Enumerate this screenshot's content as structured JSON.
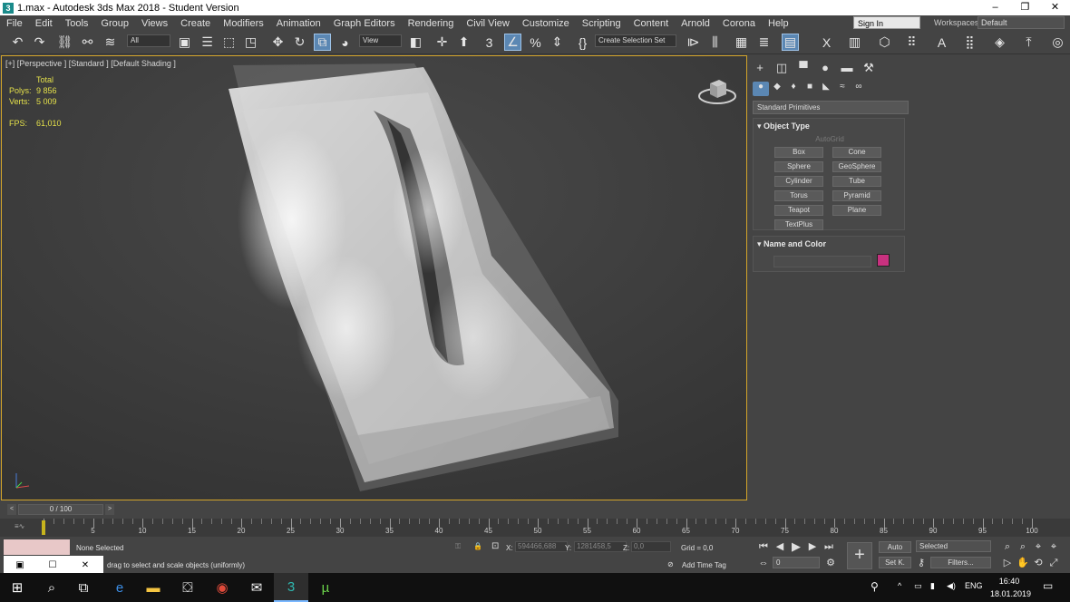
{
  "window": {
    "title": "1.max - Autodesk 3ds Max 2018 - Student Version",
    "app_icon_letter": "3",
    "minimize_glyph": "–",
    "restore_glyph": "❐",
    "close_glyph": "✕"
  },
  "menu": [
    "File",
    "Edit",
    "Tools",
    "Group",
    "Views",
    "Create",
    "Modifiers",
    "Animation",
    "Graph Editors",
    "Rendering",
    "Civil View",
    "Customize",
    "Scripting",
    "Content",
    "Arnold",
    "Corona",
    "Help"
  ],
  "account": {
    "signin_label": "Sign In",
    "workspaces_label": "Workspaces:",
    "workspace_value": "Default"
  },
  "toolbar": {
    "filter_value": "All",
    "refcoord_value": "View",
    "selection_set_value": "Create Selection Set"
  },
  "viewport": {
    "label": "[+] [Perspective ] [Standard ] [Default Shading ]",
    "stats": {
      "total_label": "Total",
      "polys_label": "Polys:",
      "polys_value": "9 856",
      "verts_label": "Verts:",
      "verts_value": "5 009",
      "fps_label": "FPS:",
      "fps_value": "61,010"
    }
  },
  "command_panel": {
    "dropdown_value": "Standard Primitives",
    "object_type_header": "Object Type",
    "autogrid_label": "AutoGrid",
    "object_buttons": [
      "Box",
      "Cone",
      "Sphere",
      "GeoSphere",
      "Cylinder",
      "Tube",
      "Torus",
      "Pyramid",
      "Teapot",
      "Plane",
      "TextPlus"
    ],
    "name_color_header": "Name and Color",
    "object_color": "#c8317f"
  },
  "timeline": {
    "slider_text": "0 / 100",
    "prev_glyph": "<",
    "next_glyph": ">",
    "ticks": [
      "5",
      "10",
      "15",
      "20",
      "25",
      "30",
      "35",
      "40",
      "45",
      "50",
      "55",
      "60",
      "65",
      "70",
      "75",
      "80",
      "85",
      "90",
      "95",
      "100"
    ]
  },
  "status": {
    "selection_text": "None Selected",
    "prompt_text": "drag to select and scale objects (uniformly)",
    "x_label": "X:",
    "x_value": "594466,688",
    "y_label": "Y:",
    "y_value": "1281458,5",
    "z_label": "Z:",
    "z_value": "0,0",
    "grid_text": "Grid = 0,0",
    "add_time_tag": "Add Time Tag",
    "frame_value": "0",
    "auto_label": "Auto",
    "setk_label": "Set K.",
    "key_mode_value": "Selected",
    "filters_label": "Filters..."
  },
  "taskbar": {
    "time": "16:40",
    "date": "18.01.2019",
    "lang": "ENG"
  }
}
